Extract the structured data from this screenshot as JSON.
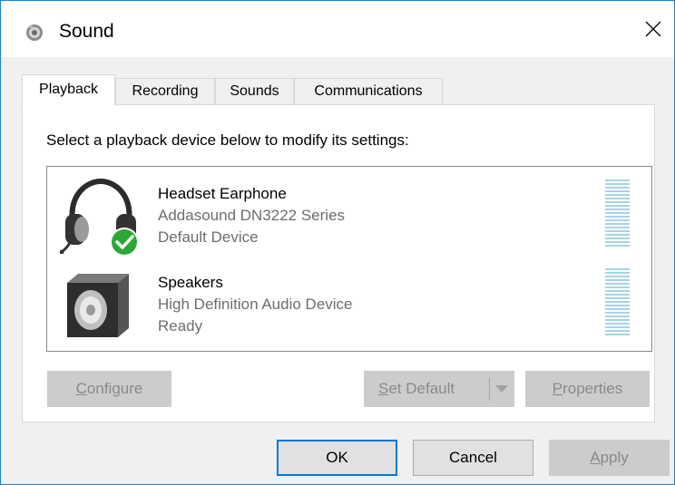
{
  "window": {
    "title": "Sound",
    "close_symbol": "✕"
  },
  "tabs": [
    {
      "label": "Playback",
      "active": true
    },
    {
      "label": "Recording",
      "active": false
    },
    {
      "label": "Sounds",
      "active": false
    },
    {
      "label": "Communications",
      "active": false
    }
  ],
  "playback": {
    "instruction": "Select a playback device below to modify its settings:",
    "devices": [
      {
        "name": "Headset Earphone",
        "description": "Addasound DN3222  Series",
        "status": "Default Device",
        "icon": "headset-icon",
        "is_default": true
      },
      {
        "name": "Speakers",
        "description": "High Definition Audio Device",
        "status": "Ready",
        "icon": "speaker-icon",
        "is_default": false
      }
    ]
  },
  "panel_buttons": {
    "configure": {
      "pre": "",
      "key": "C",
      "post": "onfigure",
      "enabled": false
    },
    "set_default": {
      "pre": "",
      "key": "S",
      "post": "et Default",
      "enabled": false
    },
    "properties": {
      "pre": "",
      "key": "P",
      "post": "roperties",
      "enabled": false
    }
  },
  "dialog_buttons": {
    "ok": {
      "label": "OK",
      "enabled": true,
      "default": true
    },
    "cancel": {
      "label": "Cancel",
      "enabled": true
    },
    "apply": {
      "pre": "",
      "key": "A",
      "post": "pply",
      "enabled": false
    }
  },
  "colors": {
    "accent": "#0078d7",
    "check_green": "#2aa836",
    "meter_blue": "#a8d3e6",
    "disabled_text": "#8a8a8a"
  }
}
